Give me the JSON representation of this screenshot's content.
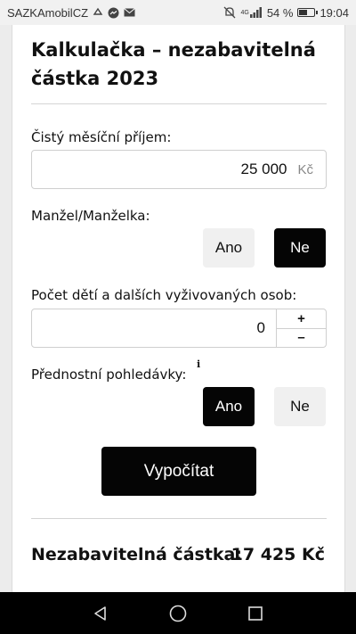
{
  "status_bar": {
    "carrier": "SAZKAmobilCZ",
    "battery_percent": "54 %",
    "battery_level": 0.54,
    "time": "19:04",
    "signal_label": "4G"
  },
  "calculator": {
    "title": "Kalkulačka – nezabavitelná částka 2023",
    "income": {
      "label": "Čistý měsíční příjem:",
      "value": "25 000",
      "unit": "Kč"
    },
    "spouse": {
      "label": "Manžel/Manželka:",
      "yes_label": "Ano",
      "no_label": "Ne",
      "selected": "no"
    },
    "dependents": {
      "label": "Počet dětí a dalších vyživovaných osob:",
      "value": "0",
      "plus_label": "+",
      "minus_label": "–"
    },
    "priority_debts": {
      "label": "Přednostní pohledávky:",
      "info_label": "i",
      "yes_label": "Ano",
      "no_label": "Ne",
      "selected": "yes"
    },
    "calculate_label": "Vypočítat",
    "result": {
      "label": "Nezabavitelná částka:",
      "value": "17 425 Kč"
    }
  }
}
